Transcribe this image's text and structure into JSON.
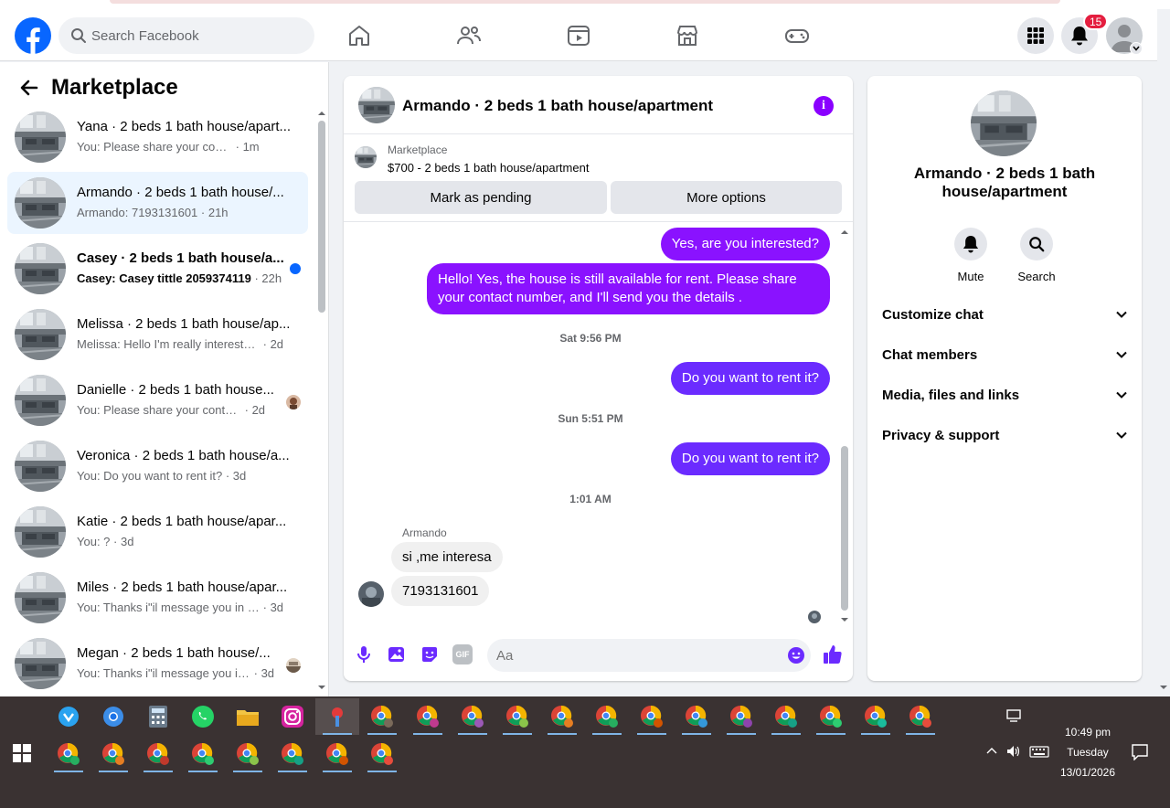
{
  "header": {
    "search_placeholder": "Search Facebook",
    "notification_count": "15"
  },
  "left": {
    "title": "Marketplace",
    "conversations": [
      {
        "title": "Yana · 2 beds 1 bath house/apart...",
        "snippet": "You: Please share your contact nu...",
        "time": "· 1m"
      },
      {
        "title": "Armando · 2 beds 1 bath house/...",
        "snippet": "Armando: 7193131601",
        "time": "· 21h"
      },
      {
        "title": "Casey · 2 beds 1 bath house/a...",
        "snippet": "Casey: Casey tittle 2059374119",
        "time": "· 22h"
      },
      {
        "title": "Melissa · 2 beds 1 bath house/ap...",
        "snippet": "Melissa: Hello I'm really interested i...",
        "time": "· 2d"
      },
      {
        "title": "Danielle · 2 beds 1 bath house...",
        "snippet": "You: Please share your contact n...",
        "time": "· 2d"
      },
      {
        "title": "Veronica · 2 beds 1 bath house/a...",
        "snippet": "You: Do you want to rent it?",
        "time": "· 3d"
      },
      {
        "title": "Katie · 2 beds 1 bath house/apar...",
        "snippet": "You: ?",
        "time": "· 3d"
      },
      {
        "title": "Miles · 2 beds 1 bath house/apar...",
        "snippet": "You: Thanks i\"il message you in a ...",
        "time": "· 3d"
      },
      {
        "title": "Megan · 2 beds 1 bath house/...",
        "snippet": "You: Thanks i\"il message you in ...",
        "time": "· 3d"
      }
    ]
  },
  "chat": {
    "title": "Armando · 2 beds 1 bath house/apartment",
    "marketplace_label": "Marketplace",
    "listing": "$700 - 2 beds 1 bath house/apartment",
    "mark_pending": "Mark as pending",
    "more_options": "More options",
    "msg1": "Yes, are you interested?",
    "msg2": "Hello! Yes, the house is still available for rent. Please share your contact number, and I'll send you the details .",
    "ts1": "Sat 9:56 PM",
    "msg3": "Do you want to rent it?",
    "ts2": "Sun 5:51 PM",
    "msg4": "Do you want to rent it?",
    "ts3": "1:01 AM",
    "sender": "Armando",
    "in1": "si ,me interesa",
    "in2": "7193131601",
    "composer_placeholder": "Aa",
    "gif_label": "GIF"
  },
  "right": {
    "name": "Armando · 2 beds 1 bath house/apartment",
    "mute": "Mute",
    "search": "Search",
    "rows": [
      "Customize chat",
      "Chat members",
      "Media, files and links",
      "Privacy & support"
    ]
  },
  "taskbar": {
    "time": "10:49 pm",
    "day": "Tuesday",
    "date": "13/01/2026"
  },
  "colors": {
    "accent": "#8a12ff",
    "facebook_blue": "#0866ff",
    "badge_red": "#e41e3f"
  }
}
